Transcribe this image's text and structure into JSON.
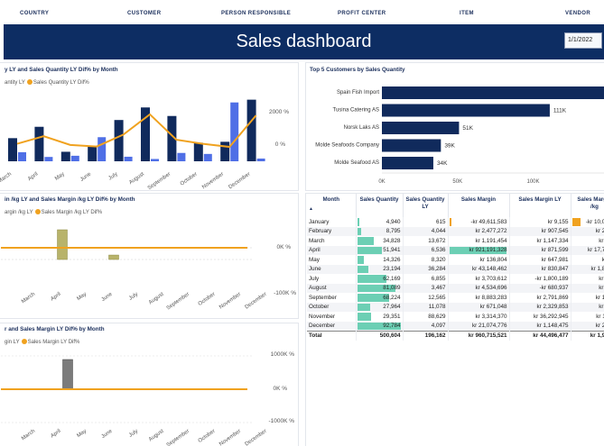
{
  "filters": [
    "COUNTRY",
    "CUSTOMER",
    "PERSON RESPONSIBLE",
    "PROFIT CENTER",
    "ITEM",
    "VENDOR"
  ],
  "header": {
    "title": "Sales dashboard",
    "date": "1/1/2022"
  },
  "colors": {
    "navy": "#0d2d63",
    "bar_dark": "#102a5c",
    "bar_light": "#4f6fe6",
    "accent": "#f0a21f",
    "olive": "#b8b36a",
    "gray_bar": "#7b7b7b",
    "teal": "#6ccfb4"
  },
  "chart1": {
    "title": "y LY and Sales Quantity LY Dif% by Month",
    "legend_series": "antity LY",
    "legend_line": "Sales Quantity LY Dif%",
    "y_right_labels": [
      "2000 %",
      "0 %"
    ]
  },
  "chart2": {
    "title": "Top 5 Customers by Sales Quantity",
    "x_ticks": [
      "0K",
      "50K",
      "100K"
    ]
  },
  "chart3": {
    "title": "in /kg LY and Sales Margin /kg LY Dif% by Month",
    "legend_series": "argin /kg LY",
    "legend_line": "Sales Margin /kg LY Dif%",
    "y_right_labels": [
      "0K %",
      "-100K %"
    ]
  },
  "chart4": {
    "title": "r and Sales Margin LY Dif% by Month",
    "legend_series": "gin LY",
    "legend_line": "Sales Margin LY Dif%",
    "y_right_labels": [
      "1000K %",
      "0K %",
      "-1000K %"
    ]
  },
  "chart_data": [
    {
      "type": "bar",
      "title": "",
      "categories": [
        "March",
        "April",
        "May",
        "June",
        "July",
        "August",
        "September",
        "October",
        "November",
        "December"
      ],
      "series": [
        {
          "name": "Sales Quantity",
          "values": [
            34828,
            51941,
            14326,
            23194,
            62169,
            81089,
            68224,
            27964,
            29351,
            92784
          ]
        },
        {
          "name": "Sales Quantity LY",
          "values": [
            13672,
            6536,
            8320,
            36284,
            6855,
            3467,
            12565,
            11078,
            88629,
            4097
          ]
        },
        {
          "name": "Sales Quantity LY Dif%",
          "type": "line",
          "values": [
            155,
            695,
            72,
            -36,
            807,
            2239,
            443,
            152,
            -67,
            2165
          ]
        }
      ]
    },
    {
      "type": "bar",
      "title": "Top 5 Customers by Sales Quantity",
      "orientation": "horizontal",
      "categories": [
        "Spain Fish Import",
        "Tusina Catering AS",
        "Norsk Laks AS",
        "Molde Seafoods Company",
        "Molde Seafood AS"
      ],
      "values": [
        150000,
        111000,
        51000,
        39000,
        34000
      ],
      "data_labels": [
        "",
        "111K",
        "51K",
        "39K",
        "34K"
      ],
      "xlim": [
        0,
        120000
      ]
    },
    {
      "type": "bar",
      "title": "",
      "categories": [
        "March",
        "April",
        "May",
        "June",
        "July",
        "August",
        "September",
        "October",
        "November",
        "December"
      ],
      "series": [
        {
          "name": "Sales Margin /kg LY",
          "values": [
            0,
            1,
            0,
            0.15,
            0,
            0,
            0,
            0,
            0,
            0
          ]
        },
        {
          "name": "Sales Margin /kg LY Dif%",
          "type": "line",
          "values": [
            0,
            0,
            0,
            0,
            0,
            0,
            0,
            0,
            0,
            0
          ]
        }
      ],
      "y_axis_labels": [
        "0K %",
        "-100K %"
      ]
    },
    {
      "type": "bar",
      "title": "",
      "categories": [
        "March",
        "April",
        "May",
        "June",
        "July",
        "August",
        "September",
        "October",
        "November",
        "December"
      ],
      "series": [
        {
          "name": "Sales Margin LY",
          "values": [
            0,
            1,
            0,
            0,
            0,
            0,
            0,
            0,
            0,
            0
          ]
        },
        {
          "name": "Sales Margin LY Dif%",
          "type": "line",
          "values": [
            0,
            0,
            0,
            0,
            0,
            0,
            0,
            0,
            0,
            0
          ]
        }
      ],
      "y_axis_labels": [
        "1000K %",
        "0K %",
        "-1000K %"
      ]
    }
  ],
  "table": {
    "columns": [
      "Month",
      "Sales Quantity",
      "Sales Quantity LY",
      "Sales Margin",
      "Sales Margin LY",
      "Sales Margin /kg"
    ],
    "rows": [
      [
        "January",
        "4,940",
        "615",
        "-kr 49,611,583",
        "kr 9,155",
        "-kr 10,043,4"
      ],
      [
        "February",
        "8,795",
        "4,044",
        "kr 2,477,272",
        "kr 907,545",
        "kr 281,6"
      ],
      [
        "March",
        "34,828",
        "13,672",
        "kr 1,191,454",
        "kr 1,147,334",
        "kr 34,2"
      ],
      [
        "April",
        "51,941",
        "6,536",
        "kr 921,191,328",
        "kr 871,599",
        "kr 17,735,2"
      ],
      [
        "May",
        "14,326",
        "8,320",
        "kr 136,804",
        "kr 647,981",
        "kr 9,5"
      ],
      [
        "June",
        "23,194",
        "36,284",
        "kr 43,148,462",
        "kr 830,847",
        "kr 1,860,3"
      ],
      [
        "July",
        "62,169",
        "6,855",
        "kr 3,703,612",
        "-kr 1,800,189",
        "kr 59,5"
      ],
      [
        "August",
        "81,089",
        "3,467",
        "kr 4,534,696",
        "-kr 680,937",
        "kr 55,9"
      ],
      [
        "September",
        "68,224",
        "12,565",
        "kr 8,883,283",
        "kr 2,791,869",
        "kr 128,2"
      ],
      [
        "October",
        "27,964",
        "11,078",
        "kr 671,048",
        "kr 2,329,853",
        "kr 24,0"
      ],
      [
        "November",
        "29,351",
        "88,629",
        "kr 3,314,370",
        "kr 36,292,945",
        "kr 112,9"
      ],
      [
        "December",
        "92,784",
        "4,097",
        "kr 21,074,776",
        "kr 1,148,475",
        "kr 227,1"
      ]
    ],
    "total": [
      "Total",
      "500,604",
      "196,162",
      "kr 960,715,521",
      "kr 44,496,477",
      "kr 1,919,3"
    ]
  }
}
